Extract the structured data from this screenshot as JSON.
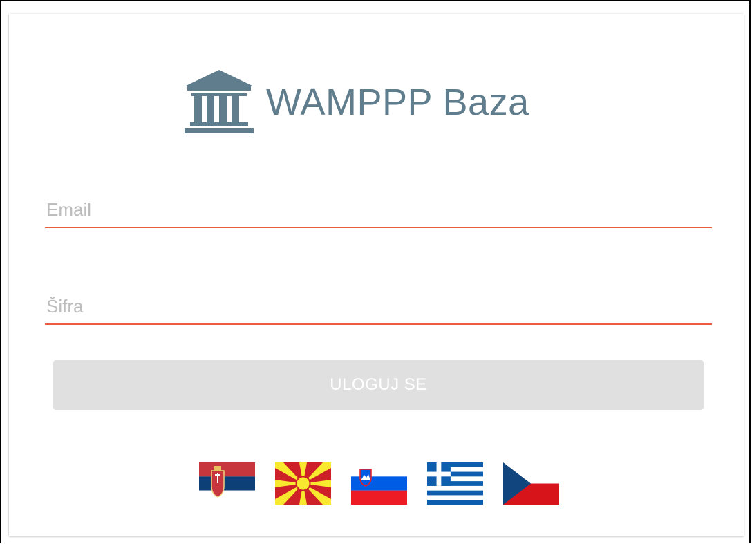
{
  "app": {
    "title": "WAMPPP Baza",
    "logo_icon": "bank-building-icon"
  },
  "form": {
    "email_placeholder": "Email",
    "email_value": "",
    "password_placeholder": "Šifra",
    "password_value": "",
    "submit_label": "ULOGUJ SE"
  },
  "languages": [
    {
      "icon": "serbia-flag-icon"
    },
    {
      "icon": "north-macedonia-flag-icon"
    },
    {
      "icon": "slovenia-flag-icon"
    },
    {
      "icon": "greece-flag-icon"
    },
    {
      "icon": "czech-flag-icon"
    }
  ],
  "colors": {
    "accent_underline": "#ef5a43",
    "logo": "#5f7d8c",
    "button_disabled_bg": "#e0e0e0",
    "placeholder": "#bdbdbd"
  }
}
